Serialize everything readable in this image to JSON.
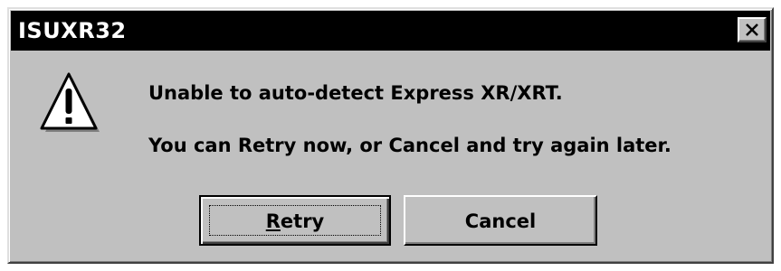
{
  "window": {
    "title": "ISUXR32",
    "close_glyph": "✕"
  },
  "message": {
    "icon": "warning-exclamation-icon",
    "line1": "Unable to auto-detect Express XR/XRT.",
    "line2": "You can Retry now, or Cancel and try again later."
  },
  "buttons": {
    "retry": {
      "mnemonic": "R",
      "rest": "etry"
    },
    "cancel": {
      "label": "Cancel"
    }
  },
  "colors": {
    "face": "#c0c0c0",
    "titlebar": "#000000",
    "title_text": "#ffffff"
  }
}
